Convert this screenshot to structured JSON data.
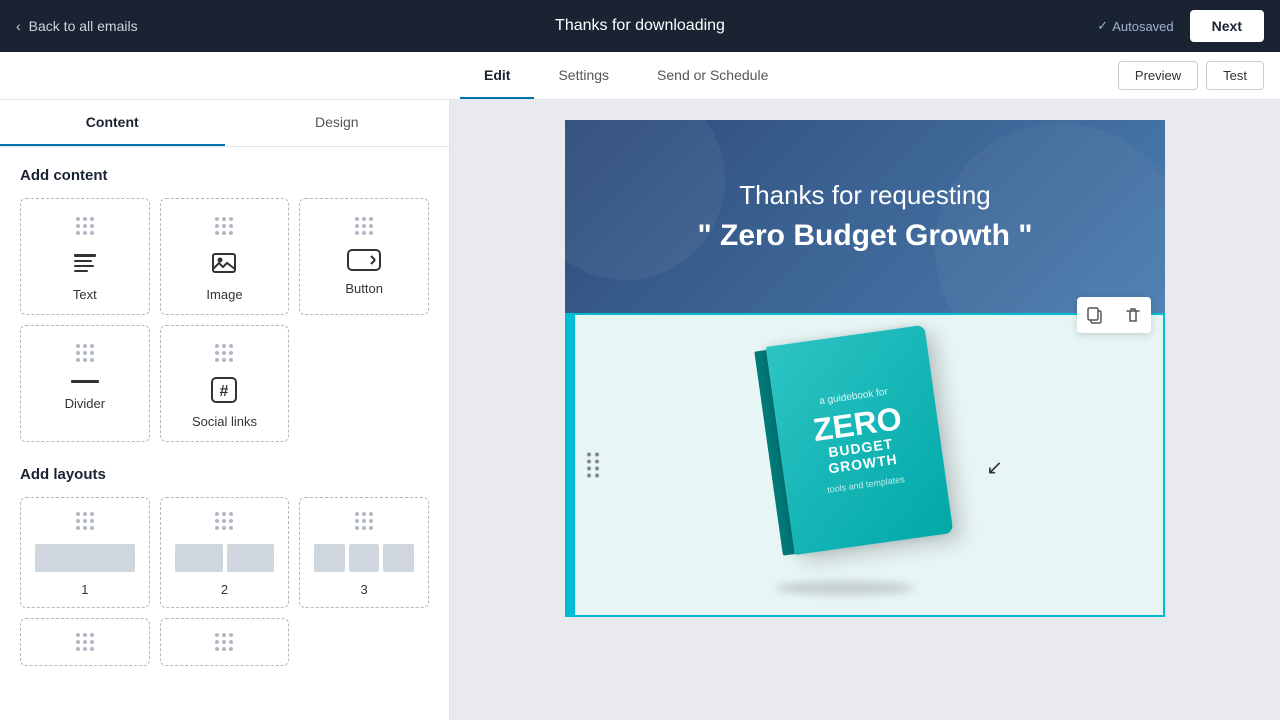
{
  "topBar": {
    "backLabel": "Back to all emails",
    "title": "Thanks for downloading",
    "autosaved": "Autosaved",
    "nextLabel": "Next"
  },
  "subNav": {
    "tabs": [
      {
        "id": "edit",
        "label": "Edit",
        "active": true
      },
      {
        "id": "settings",
        "label": "Settings",
        "active": false
      },
      {
        "id": "send-schedule",
        "label": "Send or Schedule",
        "active": false
      }
    ],
    "previewLabel": "Preview",
    "testLabel": "Test"
  },
  "sidebar": {
    "tabs": [
      {
        "id": "content",
        "label": "Content",
        "active": true
      },
      {
        "id": "design",
        "label": "Design",
        "active": false
      }
    ],
    "addContent": {
      "title": "Add content",
      "items": [
        {
          "id": "text",
          "label": "Text",
          "icon": "text-icon"
        },
        {
          "id": "image",
          "label": "Image",
          "icon": "image-icon"
        },
        {
          "id": "button",
          "label": "Button",
          "icon": "button-icon"
        },
        {
          "id": "divider",
          "label": "Divider",
          "icon": "divider-icon"
        },
        {
          "id": "social-links",
          "label": "Social links",
          "icon": "social-icon"
        }
      ]
    },
    "addLayouts": {
      "title": "Add layouts",
      "items": [
        {
          "id": "layout-1",
          "label": "1"
        },
        {
          "id": "layout-2",
          "label": "2"
        },
        {
          "id": "layout-3",
          "label": "3"
        }
      ]
    }
  },
  "emailPreview": {
    "header": {
      "subtitle": "Thanks for requesting",
      "title": "\" Zero Budget Growth \""
    },
    "bookSection": {
      "book": {
        "smallTitle": "a guidebook for",
        "titleZero": "ZERO",
        "titleBudget": "BUDGET GROWTH",
        "subtitle": "tools and templates"
      }
    },
    "floatToolbar": {
      "copyLabel": "copy",
      "deleteLabel": "delete"
    }
  },
  "colors": {
    "accent": "#0073ae",
    "navBg": "#1a2332",
    "teal": "#00bcd4"
  }
}
